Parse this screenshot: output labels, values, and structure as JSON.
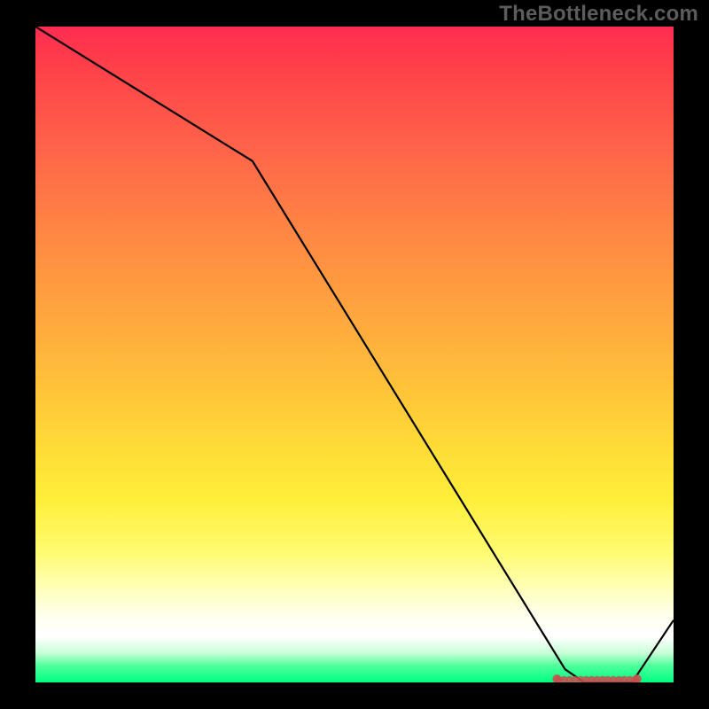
{
  "watermark": "TheBottleneck.com",
  "chart_data": {
    "type": "line",
    "x": [
      0.0,
      0.34,
      0.83,
      0.86,
      0.935,
      1.0
    ],
    "values": [
      1.0,
      0.795,
      0.02,
      0.0,
      0.0,
      0.095
    ],
    "xlim": [
      0,
      1
    ],
    "ylim": [
      0,
      1
    ],
    "xlabel": "",
    "ylabel": "",
    "title": "",
    "grid": false,
    "marker_region": {
      "start_x": 0.82,
      "end_x": 0.94,
      "y": 0.0
    },
    "marker_color": "#c94f4f",
    "line_color": "#000000"
  },
  "colors": {
    "background": "#000000",
    "watermark": "#5c5c5c"
  }
}
